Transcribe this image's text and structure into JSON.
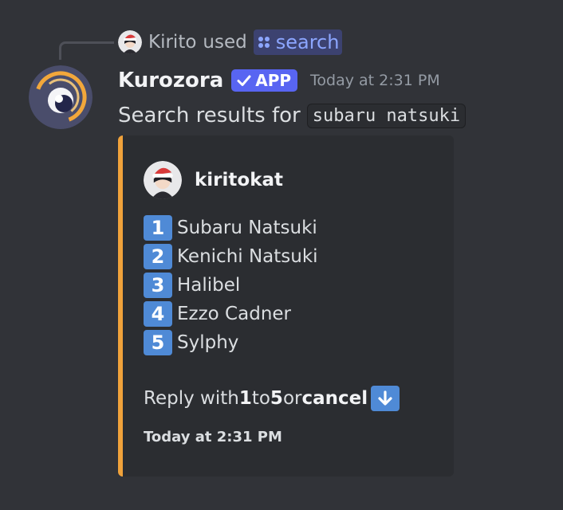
{
  "interaction": {
    "user": "Kirito",
    "used_text": "used",
    "command": "search"
  },
  "message": {
    "bot_name": "Kurozora",
    "badge": "APP",
    "timestamp": "Today at 2:31 PM",
    "content_prefix": "Search results for",
    "query": "subaru natsuki"
  },
  "embed": {
    "accent_color": "#f0a23b",
    "author": "kiritokat",
    "results": [
      {
        "key": "1",
        "name": "Subaru Natsuki"
      },
      {
        "key": "2",
        "name": "Kenichi Natsuki"
      },
      {
        "key": "3",
        "name": "Halibel"
      },
      {
        "key": "4",
        "name": "Ezzo Cadner"
      },
      {
        "key": "5",
        "name": "Sylphy"
      }
    ],
    "reply_hint": {
      "prefix": "Reply with",
      "from": "1",
      "to_word": "to",
      "to": "5",
      "or_word": "or",
      "cancel": "cancel",
      "icon": "arrow-down-icon"
    },
    "footer": "Today at 2:31 PM"
  },
  "colors": {
    "background": "#313338",
    "embed_bg": "#2b2d31",
    "app_badge": "#5865f2",
    "key_blue": "#4f8ad6",
    "command_text": "#8ca6ff"
  }
}
